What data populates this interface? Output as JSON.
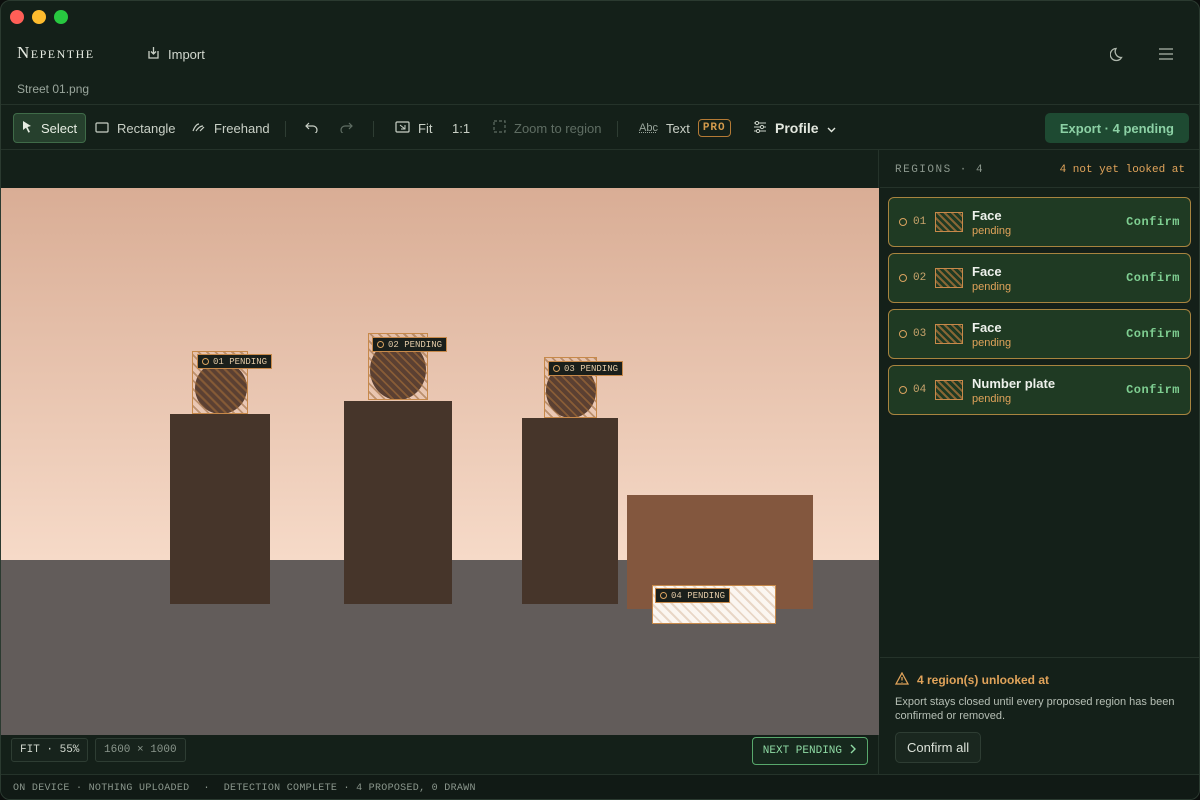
{
  "app": {
    "brand": "Nepenthe",
    "import_label": "Import",
    "filename": "Street 01.png"
  },
  "toolbar": {
    "select": "Select",
    "rectangle": "Rectangle",
    "freehand": "Freehand",
    "fit": "Fit",
    "one_to_one": "1:1",
    "zoom_region": "Zoom to region",
    "text_abc": "Abc",
    "text": "Text",
    "pro": "PRO",
    "profile": "Profile",
    "export": "Export · 4 pending"
  },
  "canvas": {
    "tags": [
      "01 PENDING",
      "02 PENDING",
      "03 PENDING",
      "04 PENDING"
    ],
    "fit_zoom": "FIT · 55%",
    "dimensions": "1600 × 1000",
    "next_pending": "NEXT PENDING"
  },
  "panel": {
    "heading": "REGIONS · 4",
    "warning": "4 not yet looked at",
    "regions": [
      {
        "num": "01",
        "title": "Face",
        "status": "pending",
        "action": "Confirm"
      },
      {
        "num": "02",
        "title": "Face",
        "status": "pending",
        "action": "Confirm"
      },
      {
        "num": "03",
        "title": "Face",
        "status": "pending",
        "action": "Confirm"
      },
      {
        "num": "04",
        "title": "Number plate",
        "status": "pending",
        "action": "Confirm"
      }
    ],
    "alert_title": "4 region(s) unlooked at",
    "alert_body": "Export stays closed until every proposed region has been confirmed or removed.",
    "confirm_all": "Confirm all"
  },
  "status": {
    "left": "ON DEVICE · NOTHING UPLOADED",
    "dot": "·",
    "right": "DETECTION COMPLETE · 4 PROPOSED, 0 DRAWN"
  },
  "colors": {
    "accent": "#d9a25f",
    "confirm": "#7fcf92",
    "panel_bg": "#142019",
    "card_bg": "#1f3a23"
  }
}
